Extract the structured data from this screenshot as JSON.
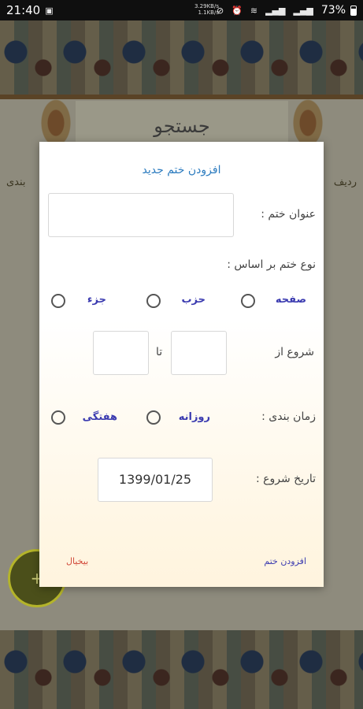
{
  "status_bar": {
    "time": "21:40",
    "net_up": "3.29KB/s",
    "net_down": "1.1KB/s",
    "battery": "73%"
  },
  "background": {
    "search_title": "جستجو",
    "side_text_left": "بندی",
    "side_text_right": "ردیف",
    "fab_icon": "plus-icon"
  },
  "dialog": {
    "title": "افزودن ختم جدید",
    "khatm_title_label": "عنوان ختم :",
    "khatm_title_value": "",
    "type_label": "نوع ختم بر اساس :",
    "type_options": [
      "صفحه",
      "حزب",
      "جزء"
    ],
    "start_from_label": "شروع از",
    "to_label": "تا",
    "from_value": "",
    "to_value": "",
    "schedule_label": "زمان بندی :",
    "schedule_options": [
      "روزانه",
      "هفتگی"
    ],
    "start_date_label": "تاریخ شروع :",
    "start_date_value": "1399/01/25",
    "add_button": "افزودن ختم",
    "cancel_button": "بیخیال"
  }
}
